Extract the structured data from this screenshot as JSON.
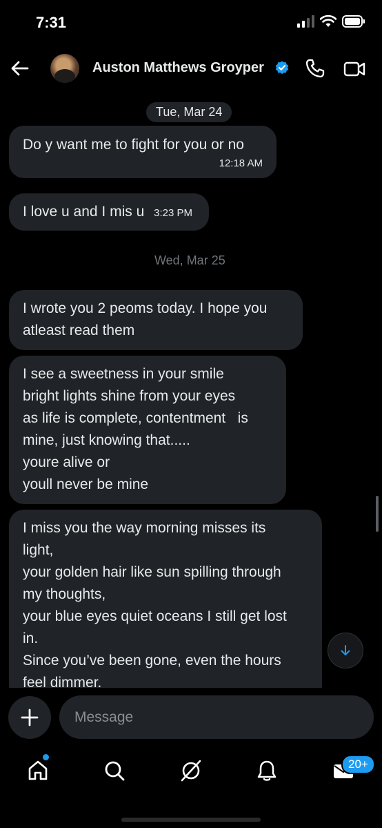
{
  "status_bar": {
    "time": "7:31"
  },
  "header": {
    "contact_name": "Auston Matthews Groyper"
  },
  "messages": [
    {
      "type": "date_chip",
      "label": "Tue, Mar 24"
    },
    {
      "type": "bubble",
      "lines": [
        "Do y want me to fight for you or no"
      ],
      "time": "12:18 AM"
    },
    {
      "type": "bubble",
      "lines": [
        "I love u and I mis u"
      ],
      "time": "3:23 PM"
    },
    {
      "type": "date",
      "label": "Wed, Mar 25"
    },
    {
      "type": "bubble",
      "lines": [
        "I wrote you 2 peoms today. I hope you",
        "atleast read them"
      ]
    },
    {
      "type": "bubble",
      "lines": [
        "I see a sweetness in your smile",
        "bright lights shine from your eyes",
        "as life is complete, contentment   is",
        "mine, just knowing that.....",
        "youre alive or",
        "youll never be mine"
      ]
    },
    {
      "type": "bubble",
      "lines": [
        "I miss you the way morning misses its",
        "light,",
        "your golden hair like sun spilling through",
        "my thoughts,",
        "your blue eyes quiet oceans I still get lost",
        "in.",
        "Since you’ve been gone, even the hours",
        "feel dimmer."
      ]
    }
  ],
  "composer": {
    "placeholder": "Message"
  },
  "tab_bar": {
    "items": [
      "home-icon",
      "search-icon",
      "grok-icon",
      "notifications-icon",
      "messages-icon"
    ],
    "messages_badge": "20+"
  },
  "colors": {
    "background": "#000000",
    "bubble": "#202327",
    "accent": "#1d9bf0",
    "text": "#e7e9ea",
    "muted": "#71767b"
  }
}
